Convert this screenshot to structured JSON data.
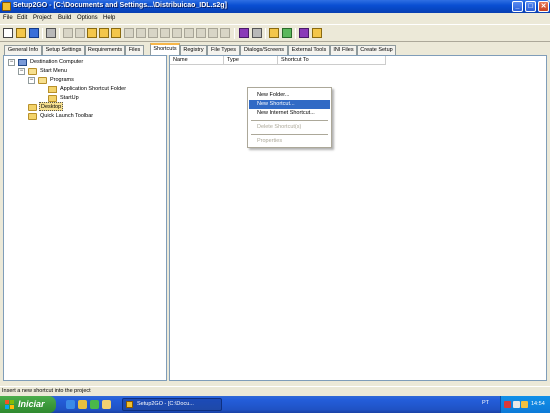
{
  "window": {
    "title": "Setup2GO - [C:\\Documents and Settings...\\Distribuicao_IDL.s2g]",
    "minimize": "_",
    "maximize": "□",
    "close": "✕"
  },
  "menu": [
    "File",
    "Edit",
    "Project",
    "Build",
    "Options",
    "Help"
  ],
  "tabs": [
    "General Info",
    "Setup Settings",
    "Requirements",
    "Files",
    "Shortcuts",
    "Registry",
    "File Types",
    "Dialogs/Screens",
    "External Tools",
    "INI Files",
    "Create Setup"
  ],
  "active_tab": "Shortcuts",
  "tree": [
    {
      "label": "Destination Computer",
      "icon": "computer-icon",
      "toggle": "−"
    },
    {
      "label": "Start Menu",
      "icon": "folder-open-icon",
      "toggle": "−"
    },
    {
      "label": "Programs",
      "icon": "folder-open-icon",
      "toggle": "−"
    },
    {
      "label": "Application Shortcut Folder",
      "icon": "folder-icon"
    },
    {
      "label": "StartUp",
      "icon": "folder-icon"
    },
    {
      "label": "Desktop",
      "icon": "folder-icon",
      "selected": true
    },
    {
      "label": "Quick Launch Toolbar",
      "icon": "folder-icon"
    }
  ],
  "list_columns": [
    "Name",
    "Type",
    "Shortcut To"
  ],
  "context_menu": {
    "items": [
      {
        "label": "New Folder...",
        "state": "normal"
      },
      {
        "label": "New Shortcut...",
        "state": "hover"
      },
      {
        "label": "New Internet Shortcut...",
        "state": "normal"
      },
      {
        "label": "Delete Shortcut(s)",
        "state": "disabled"
      },
      {
        "label": "Properties",
        "state": "disabled"
      }
    ]
  },
  "status": "Insert a new shortcut into the project",
  "taskbar": {
    "start_label": "Iniciar",
    "task_label": "Setup2GO - [C:\\Docu...",
    "language": "PT",
    "clock": "14:54"
  },
  "colors": {
    "titlebar": "#0a4fd3",
    "selection": "#316ac5",
    "active_tab_accent": "#f7b64a",
    "start_button": "#3c9a3c"
  }
}
